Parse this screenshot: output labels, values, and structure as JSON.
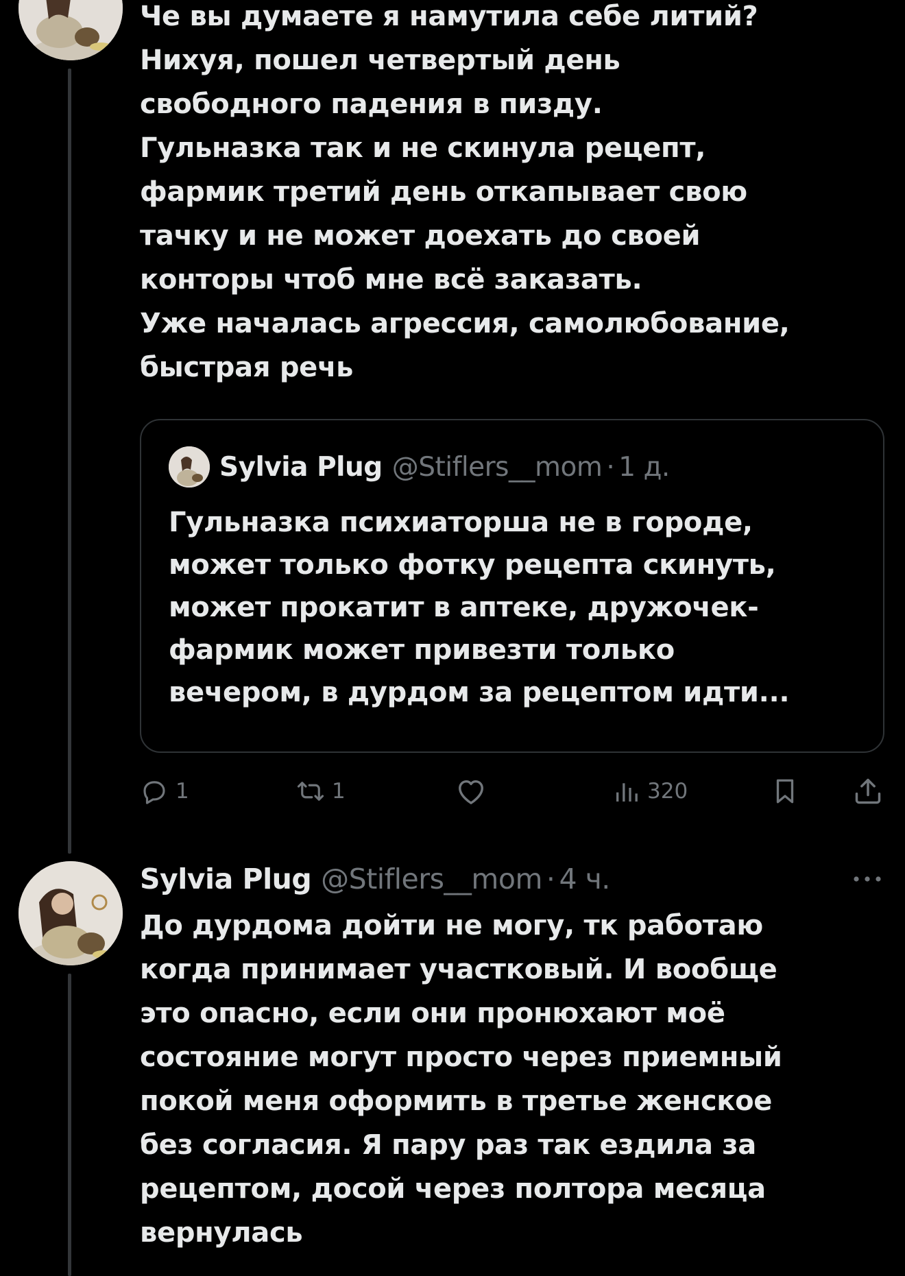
{
  "tweet1": {
    "lines": [
      "Че вы думаете я намутила себе литий?",
      "Нихуя, пошел четвертый день",
      "свободного падения в пизду.",
      "Гульназка так и не скинула рецепт,",
      "фармик третий день откапывает свою",
      "тачку и не может доехать до своей",
      "конторы чтоб мне всё заказать.",
      "Уже началась агрессия, самолюбование,",
      "быстрая речь"
    ],
    "quote": {
      "author_name": "Sylvia Plug",
      "author_handle": "@Stiflers__mom",
      "separator": "·",
      "time": "1 д.",
      "lines": [
        "Гульназка психиаторша не в городе,",
        "может только фотку рецепта скинуть,",
        "может прокатит в аптеке, дружочек-",
        "фармик может привезти только",
        "вечером, в дурдом за рецептом идти..."
      ]
    },
    "actions": {
      "reply_count": "1",
      "repost_count": "1",
      "views_count": "320",
      "icons": {
        "reply": "reply-icon",
        "repost": "repost-icon",
        "like": "heart-icon",
        "views": "views-icon",
        "bookmark": "bookmark-icon",
        "share": "share-icon"
      }
    }
  },
  "tweet2": {
    "author_name": "Sylvia Plug",
    "author_handle": "@Stiflers__mom",
    "separator": "·",
    "time": "4 ч.",
    "more_icon": "more-icon",
    "lines": [
      "До дурдома дойти не могу, тк работаю",
      "когда принимает участковый. И вообще",
      "это опасно, если они пронюхают моё",
      "состояние могут просто через приемный",
      "покой меня оформить в третье женское",
      "без согласия. Я пару раз так ездила за",
      "рецептом, досой через полтора месяца",
      "вернулась"
    ]
  },
  "colors": {
    "background": "#000000",
    "text": "#e7e9ea",
    "secondary": "#71767b",
    "border": "#2f3336",
    "thread_line": "#333639"
  }
}
